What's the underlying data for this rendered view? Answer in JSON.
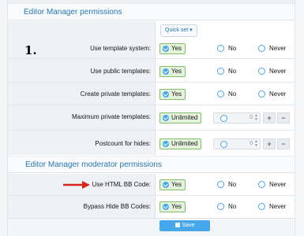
{
  "sections": [
    {
      "title": "Editor Manager permissions"
    },
    {
      "title": "Editor Manager moderator permissions"
    }
  ],
  "quick_set": {
    "label": "Quick set ▾"
  },
  "step_marker": "1.",
  "rows": [
    {
      "label": "Use template system:",
      "selected": "Yes",
      "options": [
        "No",
        "Never"
      ]
    },
    {
      "label": "Use public templates:",
      "selected": "Yes",
      "options": [
        "No",
        "Never"
      ]
    },
    {
      "label": "Create private templates:",
      "selected": "Yes",
      "options": [
        "No",
        "Never"
      ]
    },
    {
      "label": "Maximum private templates:",
      "selected": "Unlimited",
      "number_value": "0"
    },
    {
      "label": "Postcount for hides:",
      "selected": "Unlimited",
      "number_value": "0"
    },
    {
      "label": "Use HTML BB Code:",
      "selected": "Yes",
      "options": [
        "No",
        "Never"
      ]
    },
    {
      "label": "Bypass Hide BB Codes:",
      "selected": "Yes",
      "options": [
        "No",
        "Never"
      ]
    }
  ],
  "stepper": {
    "decrement": "−",
    "increment": "+"
  },
  "save_label": "Save",
  "icons": {
    "pill": "check-circle-icon",
    "save": "save-icon",
    "pointer": "red-arrow-icon"
  },
  "colors": {
    "accent": "#47a7eb",
    "header_text": "#2577b1",
    "pill_border": "#7fbf6a",
    "arrow": "#d9261c"
  }
}
